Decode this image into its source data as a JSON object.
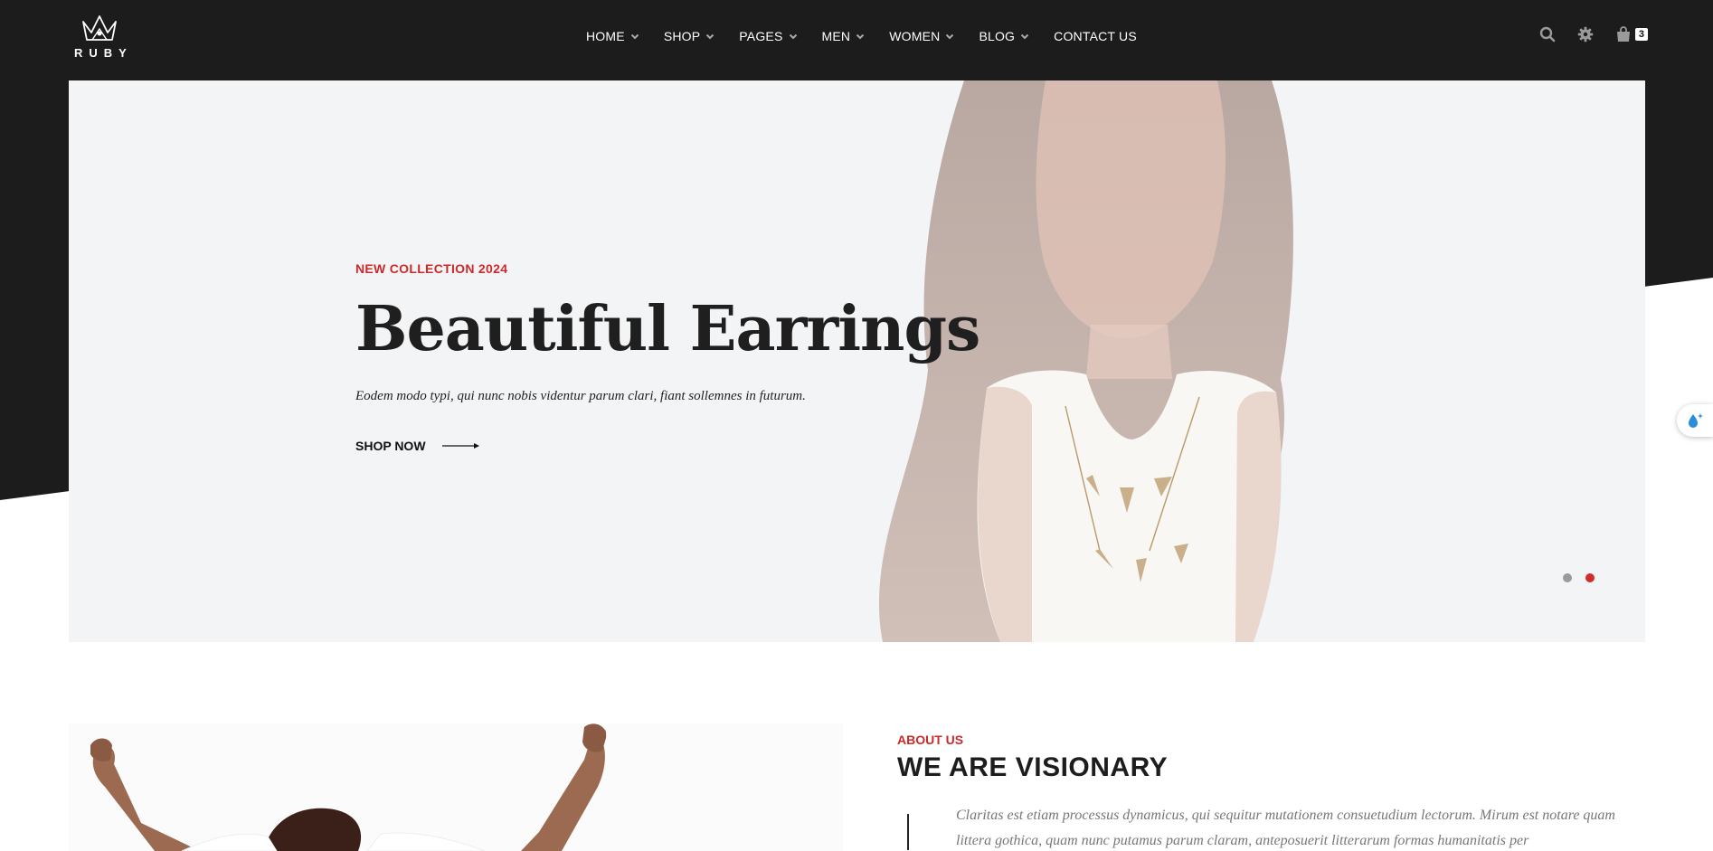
{
  "brand": {
    "logo_text": "RUBY"
  },
  "nav": {
    "items": [
      {
        "label": "HOME",
        "dropdown": true
      },
      {
        "label": "SHOP",
        "dropdown": true
      },
      {
        "label": "PAGES",
        "dropdown": true
      },
      {
        "label": "MEN",
        "dropdown": true
      },
      {
        "label": "WOMEN",
        "dropdown": true
      },
      {
        "label": "BLOG",
        "dropdown": true
      },
      {
        "label": "CONTACT US",
        "dropdown": false
      }
    ]
  },
  "tools": {
    "search_icon": "search-icon",
    "settings_icon": "gear-icon",
    "cart_icon": "shopping-bag-icon",
    "cart_count": "3"
  },
  "hero": {
    "eyebrow": "NEW COLLECTION 2024",
    "title": "Beautiful Earrings",
    "subtitle": "Eodem modo typi, qui nunc nobis videntur parum clari, fiant sollemnes in futurum.",
    "cta": "SHOP NOW",
    "slides_total": 2,
    "active_slide": 2
  },
  "about": {
    "eyebrow": "ABOUT US",
    "title": "WE ARE VISIONARY",
    "text": "Claritas est etiam processus dynamicus, qui sequitur mutationem consuetudium lectorum. Mirum est notare quam littera gothica, quam nunc putamus parum claram, anteposuerit litterarum formas humanitatis per"
  },
  "colors": {
    "header_bg": "#1c1c1c",
    "accent": "#cc2a2a",
    "hero_bg": "#f3f4f6"
  }
}
